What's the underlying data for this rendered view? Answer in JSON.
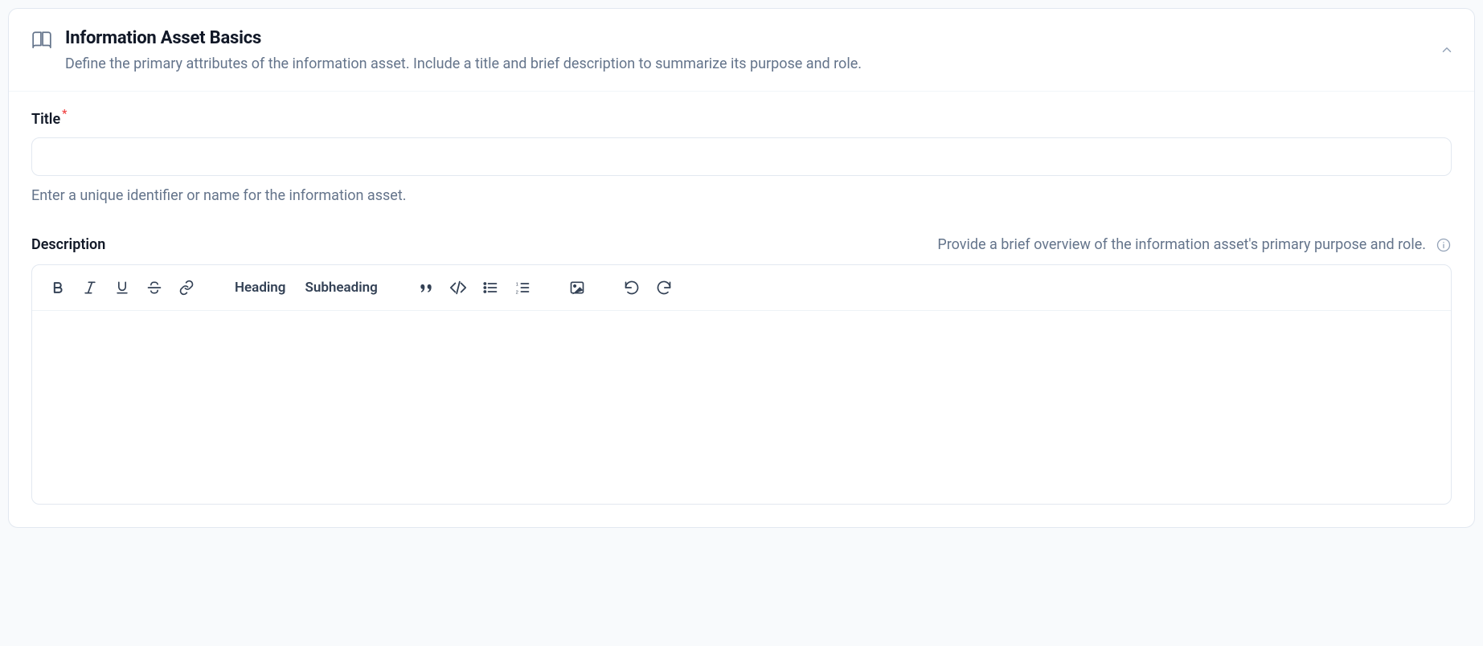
{
  "header": {
    "title": "Information Asset Basics",
    "subtitle": "Define the primary attributes of the information asset. Include a title and brief description to summarize its purpose and role."
  },
  "fields": {
    "title": {
      "label": "Title",
      "required_marker": "*",
      "value": "",
      "helper": "Enter a unique identifier or name for the information asset."
    },
    "description": {
      "label": "Description",
      "hint": "Provide a brief overview of the information asset's primary purpose and role.",
      "value": ""
    }
  },
  "toolbar": {
    "heading_label": "Heading",
    "subheading_label": "Subheading"
  }
}
